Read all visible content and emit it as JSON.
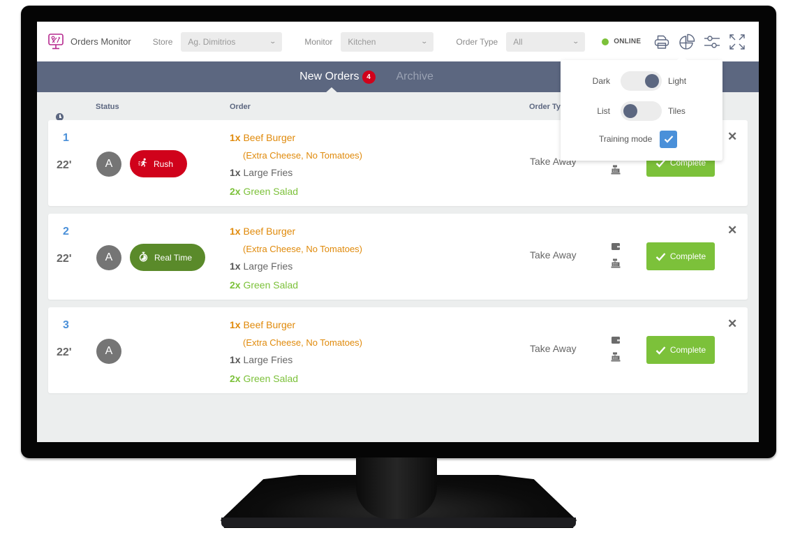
{
  "app": {
    "title": "Orders Monitor",
    "brand_color": "#b5288e"
  },
  "filters": {
    "store": {
      "label": "Store",
      "value": "Ag. Dimitrios"
    },
    "monitor": {
      "label": "Monitor",
      "value": "Kitchen"
    },
    "order_type": {
      "label": "Order Type",
      "value": "All"
    }
  },
  "status": {
    "text": "ONLINE",
    "color": "#7cc13a"
  },
  "toolbar_icons": [
    "printer-icon",
    "pie-chart-icon",
    "sliders-icon",
    "fullscreen-icon"
  ],
  "tabs": [
    {
      "label": "New Orders",
      "badge": "4",
      "active": true
    },
    {
      "label": "Archive",
      "active": false
    }
  ],
  "columns": {
    "number_time": "# /",
    "status": "Status",
    "order": "Order",
    "order_type": "Order Type"
  },
  "settings": {
    "theme": {
      "left": "Dark",
      "right": "Light",
      "selected": "Light"
    },
    "view": {
      "left": "List",
      "right": "Tiles",
      "selected": "List"
    },
    "training_mode": {
      "label": "Training mode",
      "checked": true
    }
  },
  "orders": [
    {
      "number": "1",
      "elapsed": "22'",
      "avatar": "A",
      "tag": {
        "label": "Rush",
        "icon": "running-person-icon",
        "color": "#d0021b"
      },
      "items": [
        {
          "qty": "1x",
          "name": "Beef Burger",
          "note": "(Extra Cheese, No Tomatoes)",
          "color": "orange"
        },
        {
          "qty": "1x",
          "name": "Large Fries",
          "color": "gray"
        },
        {
          "qty": "2x",
          "name": "Green Salad",
          "color": "green"
        }
      ],
      "order_type": "Take Away",
      "action": "Complete"
    },
    {
      "number": "2",
      "elapsed": "22'",
      "avatar": "A",
      "tag": {
        "label": "Real Time",
        "icon": "stopwatch-icon",
        "color": "#5a8a2a"
      },
      "items": [
        {
          "qty": "1x",
          "name": "Beef Burger",
          "note": "(Extra Cheese, No Tomatoes)",
          "color": "orange"
        },
        {
          "qty": "1x",
          "name": "Large Fries",
          "color": "gray"
        },
        {
          "qty": "2x",
          "name": "Green Salad",
          "color": "green"
        }
      ],
      "order_type": "Take Away",
      "action": "Complete"
    },
    {
      "number": "3",
      "elapsed": "22'",
      "avatar": "A",
      "items": [
        {
          "qty": "1x",
          "name": "Beef Burger",
          "note": "(Extra Cheese, No Tomatoes)",
          "color": "orange"
        },
        {
          "qty": "1x",
          "name": "Large Fries",
          "color": "gray"
        },
        {
          "qty": "2x",
          "name": "Green Salad",
          "color": "green"
        }
      ],
      "order_type": "Take Away",
      "action": "Complete"
    }
  ]
}
